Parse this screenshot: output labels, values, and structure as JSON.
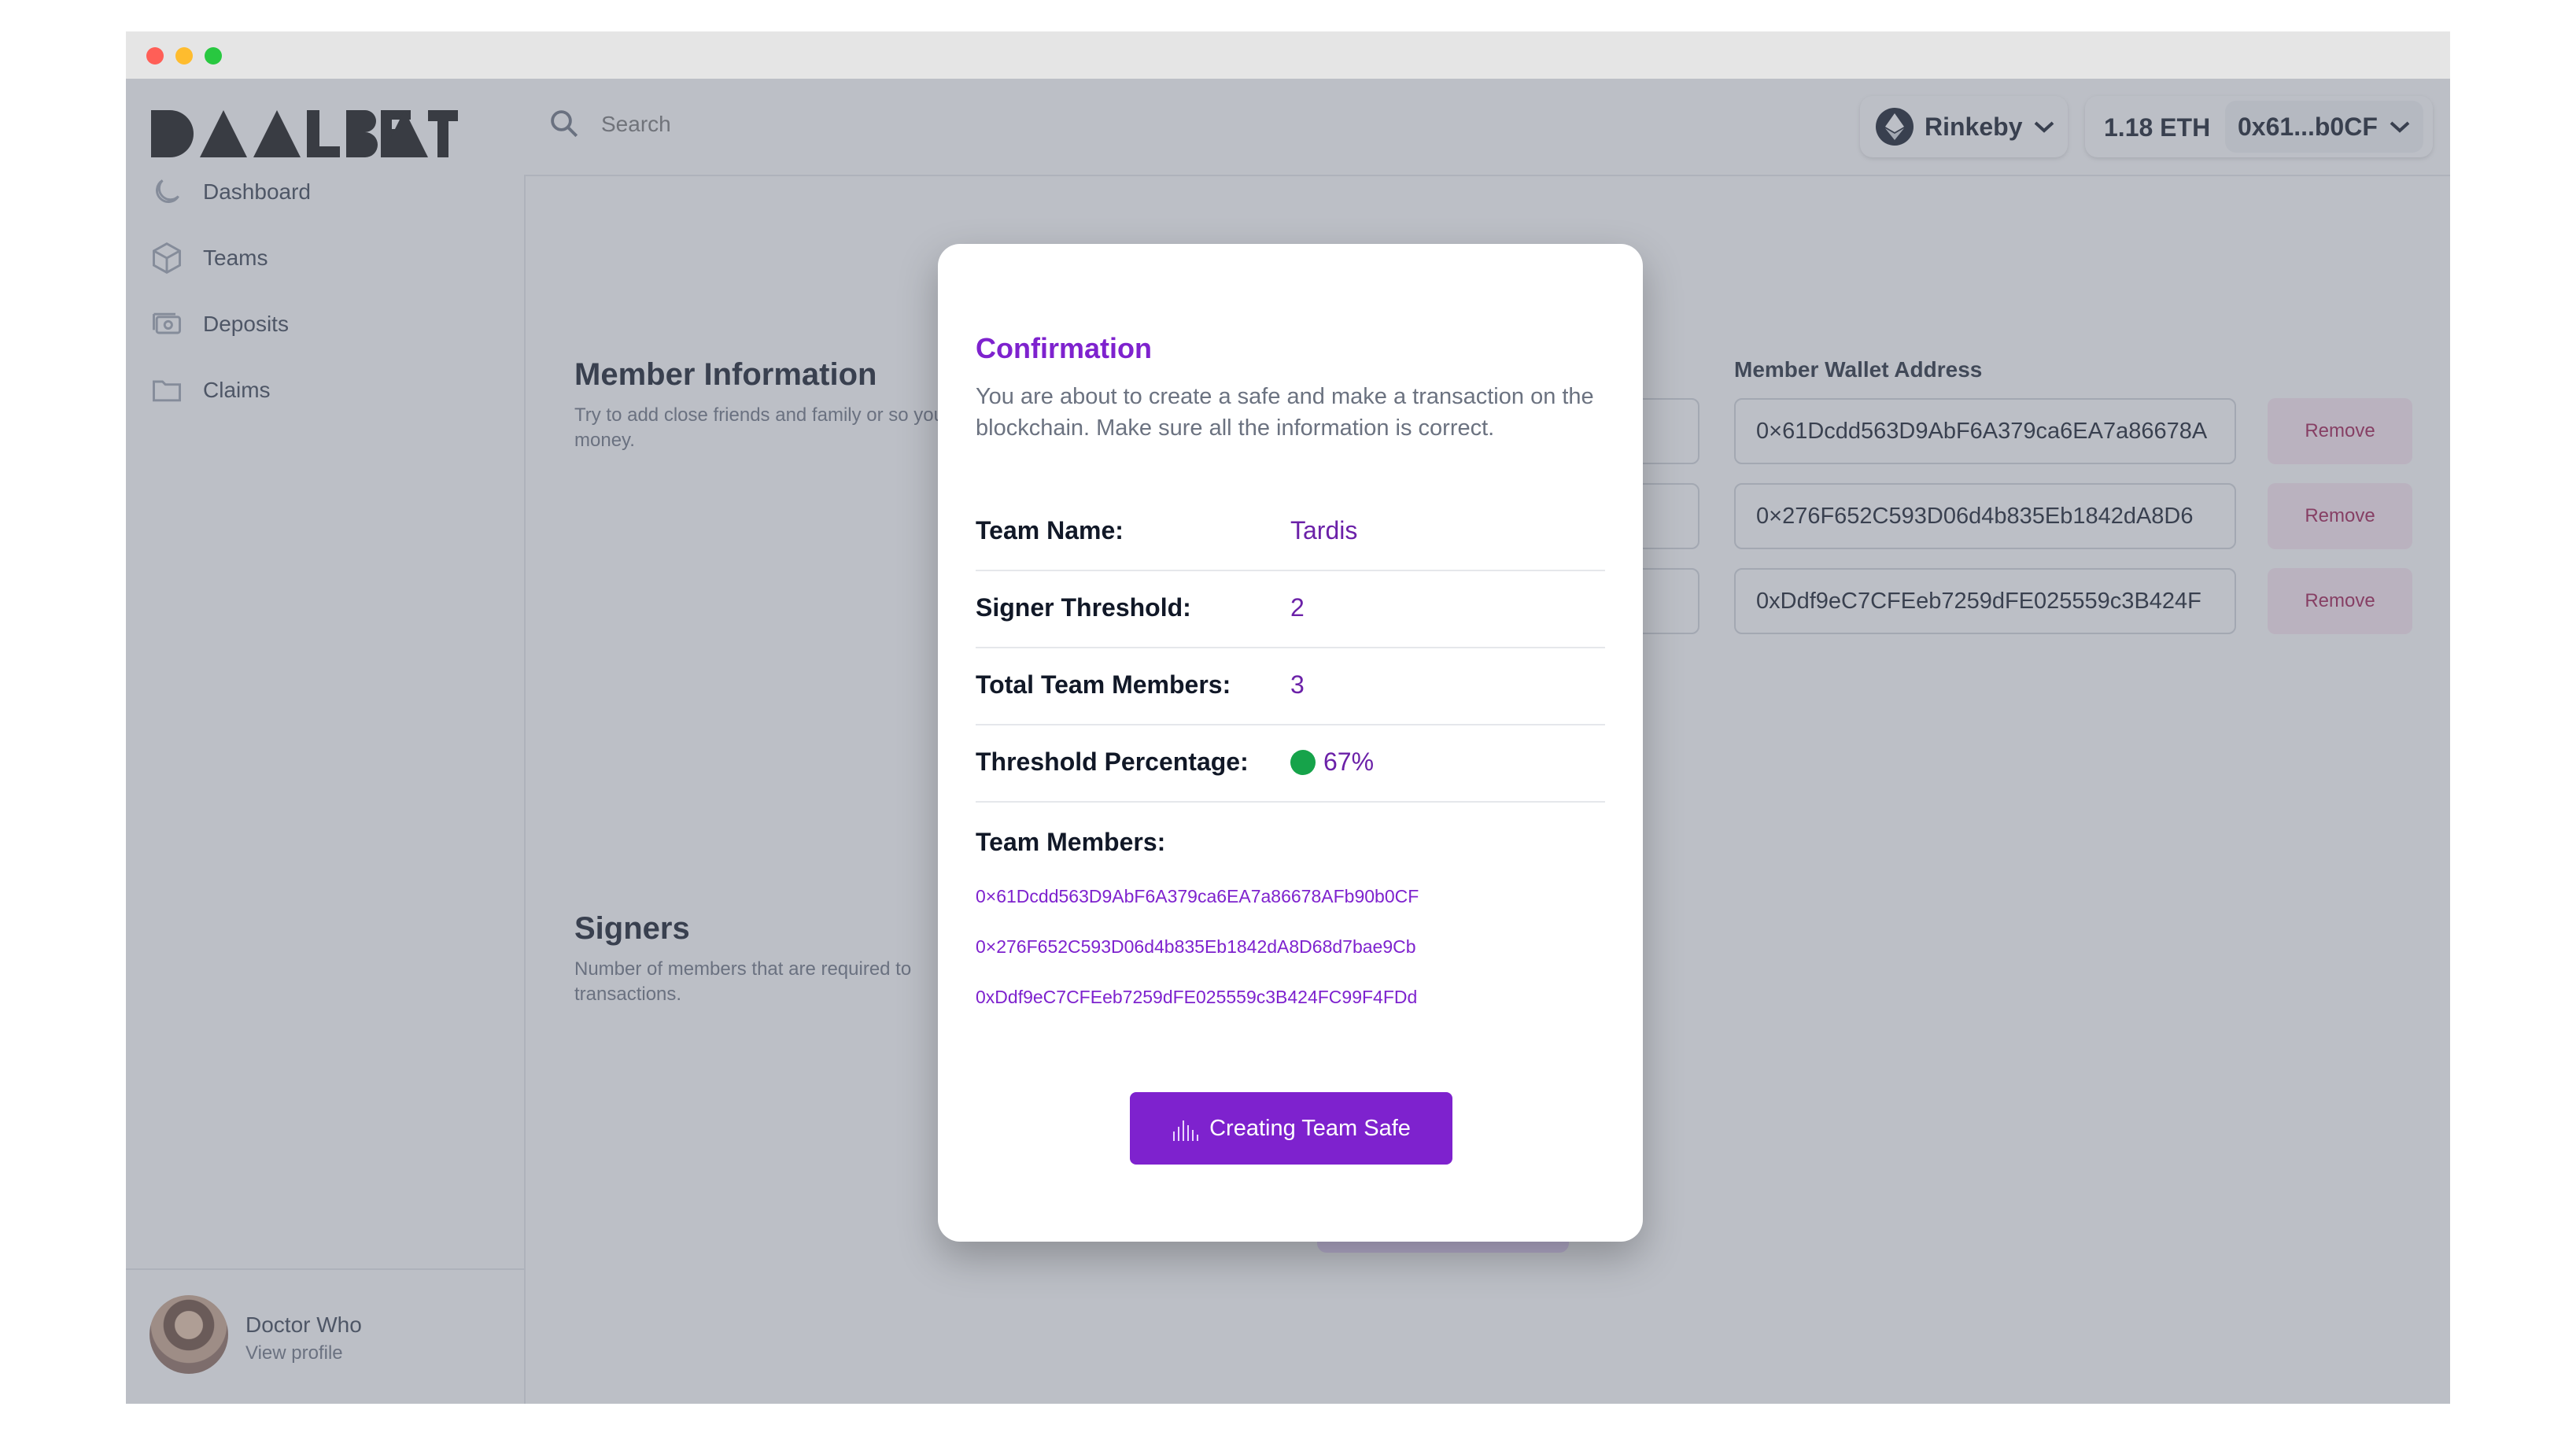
{
  "window": {
    "traffic_lights": [
      "close",
      "minimize",
      "zoom"
    ]
  },
  "brand": {
    "logo_text": "DAALBEAT"
  },
  "sidebar": {
    "items": [
      {
        "label": "Dashboard",
        "icon": "moon-icon"
      },
      {
        "label": "Teams",
        "icon": "cube-icon"
      },
      {
        "label": "Deposits",
        "icon": "cash-icon"
      },
      {
        "label": "Claims",
        "icon": "folder-icon"
      }
    ]
  },
  "profile": {
    "name": "Doctor Who",
    "link": "View profile"
  },
  "header": {
    "search_placeholder": "Search",
    "network": "Rinkeby",
    "balance": "1.18 ETH",
    "address": "0x61...b0CF"
  },
  "background": {
    "member_info_title": "Member Information",
    "member_info_desc": "Try to add close friends and family or so your money.",
    "wallet_column_label": "Member Wallet Address",
    "wallets": [
      "0×61Dcdd563D9AbF6A379ca6EA7a86678A",
      "0×276F652C593D06d4b835Eb1842dA8D6",
      "0xDdf9eC7CFEeb7259dFE025559c3B424F"
    ],
    "remove_label": "Remove",
    "signers_title": "Signers",
    "signers_desc": "Number of members that are required to transactions."
  },
  "modal": {
    "title": "Confirmation",
    "description": "You are about to create a safe and make a transaction on the blockchain. Make sure all the information is correct.",
    "rows": [
      {
        "label": "Team Name:",
        "value": "Tardis"
      },
      {
        "label": "Signer Threshold:",
        "value": "2"
      },
      {
        "label": "Total Team Members:",
        "value": "3"
      },
      {
        "label": "Threshold Percentage:",
        "value": "67%"
      }
    ],
    "members_label": "Team Members:",
    "members": [
      "0×61Dcdd563D9AbF6A379ca6EA7a86678AFb90b0CF",
      "0×276F652C593D06d4b835Eb1842dA8D68d7bae9Cb",
      "0xDdf9eC7CFEeb7259dFE025559c3B424FC99F4FDd"
    ],
    "button_label": "Creating Team Safe"
  },
  "colors": {
    "accent": "#7e22ce",
    "status_ok": "#16a34a",
    "remove_bg": "#fce7f3"
  }
}
